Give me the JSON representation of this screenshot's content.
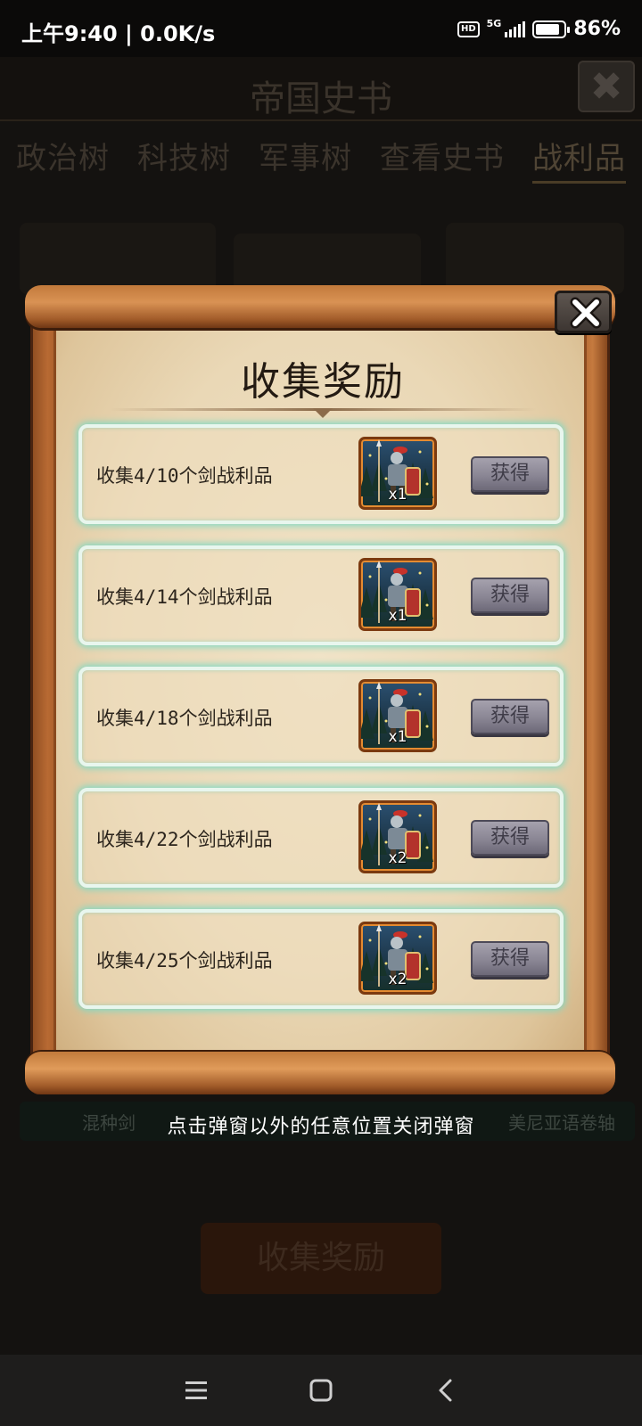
{
  "status_bar": {
    "time": "上午9:40 | 0.0K/s",
    "hd": "HD",
    "network": "5G",
    "battery_level": 0.86,
    "battery_text": "86%"
  },
  "background": {
    "title": "帝国史书",
    "close_icon": "close-icon",
    "tabs": [
      "政治树",
      "科技树",
      "军事树",
      "查看史书",
      "战利品"
    ],
    "active_tab": "战利品",
    "strip_left": "混种剑",
    "strip_right": "美尼亚语卷轴",
    "button": "收集奖励"
  },
  "dialog": {
    "title": "收集奖励",
    "rewards": [
      {
        "label": "收集4/10个剑战利品",
        "qty": "x1",
        "button": "获得"
      },
      {
        "label": "收集4/14个剑战利品",
        "qty": "x1",
        "button": "获得"
      },
      {
        "label": "收集4/18个剑战利品",
        "qty": "x1",
        "button": "获得"
      },
      {
        "label": "收集4/22个剑战利品",
        "qty": "x2",
        "button": "获得"
      },
      {
        "label": "收集4/25个剑战利品",
        "qty": "x2",
        "button": "获得"
      }
    ],
    "dismiss_hint": "点击弹窗以外的任意位置关闭弹窗"
  },
  "colors": {
    "row_glow": "#7fd9c4",
    "scroll_wood": "#a45a27",
    "claim_disabled": "#8a8694"
  },
  "navbar": {
    "icons": [
      "menu-icon",
      "home-icon",
      "back-icon"
    ]
  }
}
